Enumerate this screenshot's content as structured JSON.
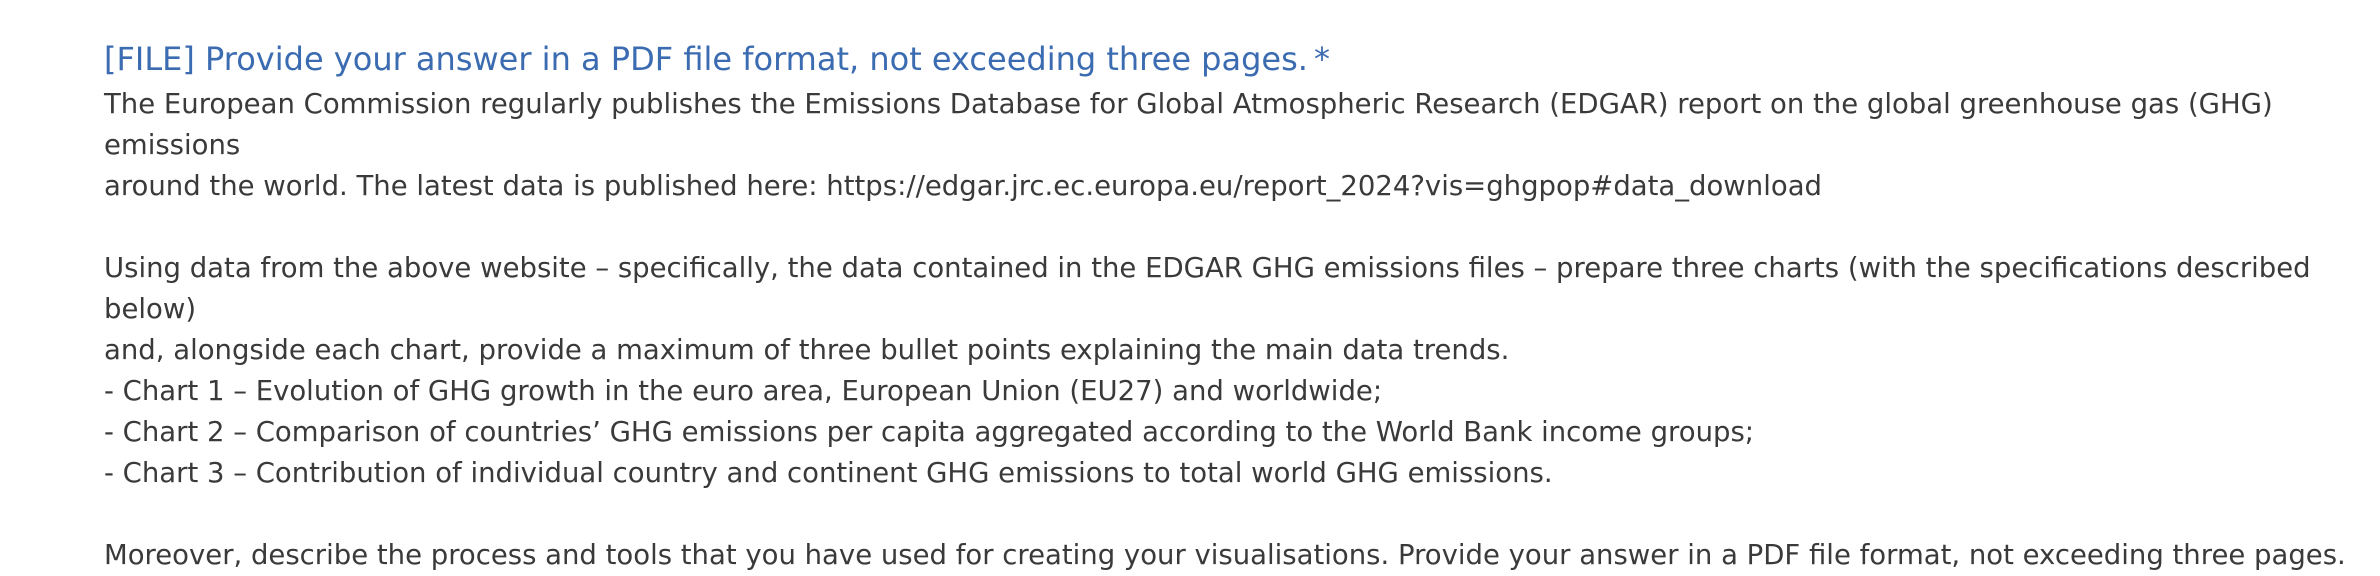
{
  "question": {
    "title": "[FILE] Provide your answer in a PDF file format, not exceeding three pages.",
    "required_marker": "*",
    "description": {
      "line_1": "The European Commission regularly publishes the Emissions Database for Global Atmospheric Research (EDGAR) report on the global greenhouse gas (GHG) emissions",
      "line_2": "around the world. The latest data is published here: https://edgar.jrc.ec.europa.eu/report_2024?vis=ghgpop#data_download",
      "line_3": "Using data from the above website – specifically, the data contained in the EDGAR GHG emissions files – prepare three charts (with the specifications described below)",
      "line_4": "and, alongside each chart, provide a maximum of three bullet points explaining the main data trends.",
      "chart_1": "- Chart 1 – Evolution of GHG growth in the euro area, European Union (EU27) and worldwide;",
      "chart_2": "- Chart 2 – Comparison of countries’ GHG emissions per capita aggregated according to the World Bank income groups;",
      "chart_3": "- Chart 3 – Contribution of individual country and continent GHG emissions to total world GHG emissions.",
      "closing": "Moreover, describe the process and tools that you have used for creating your visualisations. Provide your answer in a PDF file format, not exceeding three pages."
    }
  },
  "colors": {
    "title": "#3b6bb0",
    "text": "#3a3a3a",
    "background": "#ffffff"
  }
}
